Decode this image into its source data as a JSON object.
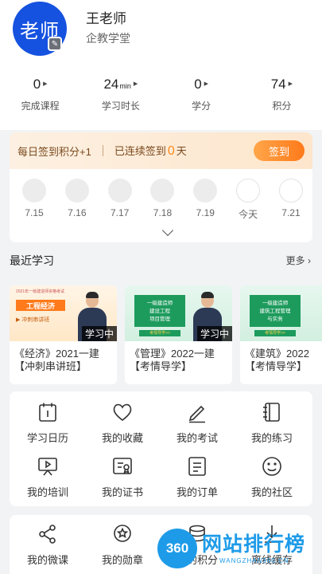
{
  "profile": {
    "avatar_text": "老师",
    "name": "王老师",
    "org": "企教学堂"
  },
  "stats": [
    {
      "value": "0",
      "unit": "",
      "label": "完成课程"
    },
    {
      "value": "24",
      "unit": "min",
      "label": "学习时长"
    },
    {
      "value": "0",
      "unit": "",
      "label": "学分"
    },
    {
      "value": "74",
      "unit": "",
      "label": "积分"
    }
  ],
  "checkin": {
    "tip": "每日签到积分+1",
    "streak_prefix": "已连续签到",
    "streak_count": "0",
    "streak_suffix": "天",
    "button": "签到",
    "days": [
      "7.15",
      "7.16",
      "7.17",
      "7.18",
      "7.19",
      "今天",
      "7.21"
    ]
  },
  "recent": {
    "title": "最近学习",
    "more": "更多",
    "badge": "学习中",
    "courses": [
      {
        "line1": "《经济》2021一建",
        "line2": "【冲刺串讲班】",
        "thumb_head": "2021年一级建造师资格考试",
        "thumb_title": "工程经济",
        "thumb_sub": "▶ 冲刺串讲班"
      },
      {
        "line1": "《管理》2022一建",
        "line2": "【考情导学】",
        "thumb_head": "一级建造师",
        "thumb_title": "建设工程\n项目管理",
        "thumb_sub": "考情导学>>"
      },
      {
        "line1": "《建筑》2022",
        "line2": "【考情导学】",
        "thumb_head": "一级建造师",
        "thumb_title": "建筑工程管理\n与实务",
        "thumb_sub": "考情导学>>"
      }
    ]
  },
  "menu": [
    {
      "label": "学习日历",
      "icon": "calendar-icon"
    },
    {
      "label": "我的收藏",
      "icon": "heart-icon"
    },
    {
      "label": "我的考试",
      "icon": "pen-icon"
    },
    {
      "label": "我的练习",
      "icon": "notebook-icon"
    },
    {
      "label": "我的培训",
      "icon": "board-icon"
    },
    {
      "label": "我的证书",
      "icon": "certificate-icon"
    },
    {
      "label": "我的订单",
      "icon": "order-icon"
    },
    {
      "label": "我的社区",
      "icon": "smile-icon"
    }
  ],
  "menu2": [
    {
      "label": "我的微课",
      "icon": "share-icon"
    },
    {
      "label": "我的勋章",
      "icon": "medal-icon"
    },
    {
      "label": "我的积分",
      "icon": "coins-icon"
    },
    {
      "label": "离线缓存",
      "icon": "download-icon"
    }
  ],
  "watermark": {
    "logo": "360",
    "text": "网站排行榜",
    "sub": "WANGZHAN360.CN"
  }
}
